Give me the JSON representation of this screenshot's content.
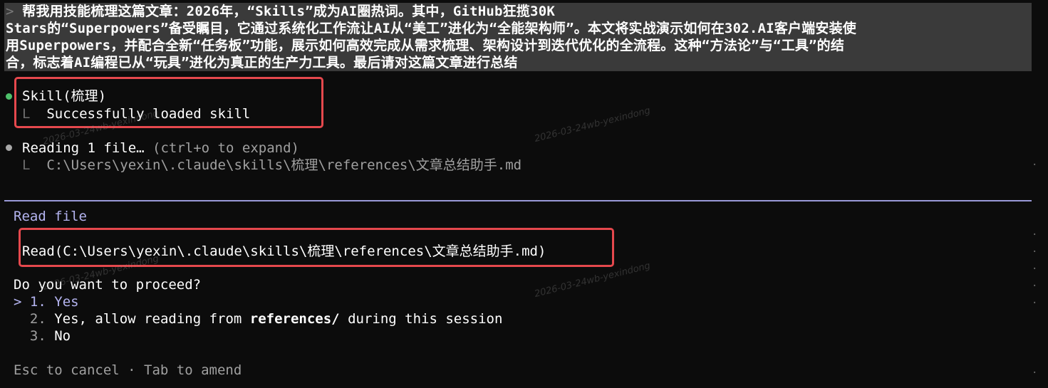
{
  "prompt": {
    "caret": ">",
    "lines": [
      " 帮我用技能梳理这篇文章：2026年，“Skills”成为AI圈热词。其中，GitHub狂揽30K",
      "Stars的“Superpowers”备受瞩目，它通过系统化工作流让AI从“美工”进化为“全能架构师”。本文将实战演示如何在302.AI客户端安装使",
      "用Superpowers，并配合全新“任务板”功能，展示如何高效完成从需求梳理、架构设计到迭代优化的全流程。这种“方法论”与“工具”的结",
      "合，标志着AI编程已从“玩具”进化为真正的生产力工具。最后请对这篇文章进行总结"
    ]
  },
  "skill": {
    "title": "Skill(梳理)",
    "corner": "L",
    "result": "Successfully loaded skill"
  },
  "reading": {
    "title": "Reading 1 file…",
    "hint": "(ctrl+o to expand)",
    "corner": "L",
    "path": "C:\\Users\\yexin\\.claude\\skills\\梳理\\references\\文章总结助手.md"
  },
  "dialog": {
    "heading": "Read file",
    "command": "Read(C:\\Users\\yexin\\.claude\\skills\\梳理\\references\\文章总结助手.md)",
    "question": "Do you want to proceed?",
    "options": [
      {
        "pointer": ">",
        "number": "1.",
        "label": "Yes"
      },
      {
        "number": "2.",
        "pre": "Yes, allow reading from ",
        "strong": "references/",
        "post": " during this session"
      },
      {
        "number": "3.",
        "label": "No"
      }
    ],
    "footer": "Esc to cancel · Tab to amend"
  },
  "watermark": "2026-03-24wb-yexindong",
  "colors": {
    "background": "#0c0c0c",
    "prompt_bg": "#3a3a3a",
    "bullet_done": "#4ec16b",
    "bullet_pending": "#a8a8a8",
    "accent": "#b4b4f0",
    "highlight_box": "#e5484d"
  }
}
